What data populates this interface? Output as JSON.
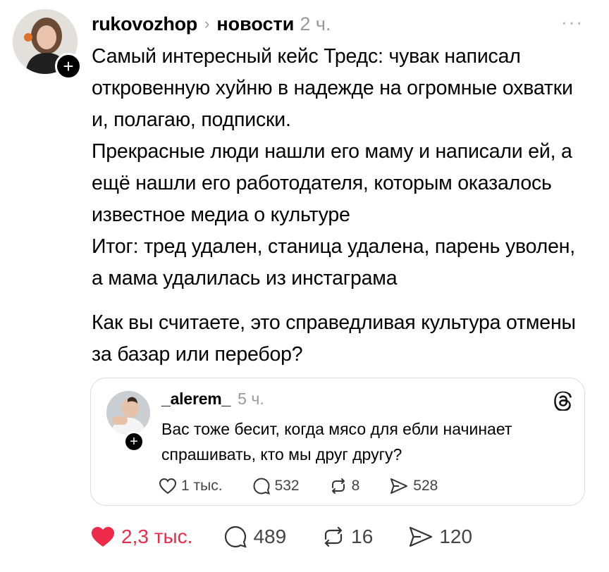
{
  "post": {
    "username": "rukovozhop",
    "topic": "новости",
    "time": "2 ч.",
    "more": "···",
    "follow": "+",
    "paragraphs": [
      "Самый интересный кейс Тредс: чувак написал откровенную хуйню в надежде на огромные охватки и, полагаю, подписки.",
      "Прекрасные люди нашли его маму и написали ей, а ещё нашли его работодателя, которым оказалось известное медиа о культуре",
      "Итог: тред удален, станица удалена, парень уволен, а мама удалилась из инстаграма",
      "Как вы считаете, это справедливая культура отмены за базар или перебор?"
    ],
    "actions": {
      "likes": "2,3 тыс.",
      "comments": "489",
      "reposts": "16",
      "shares": "120"
    }
  },
  "quoted": {
    "username": "_alerem_",
    "time": "5 ч.",
    "follow": "+",
    "text": "Вас тоже бесит, когда мясо для ебли начинает спрашивать, кто мы друг другу?",
    "actions": {
      "likes": "1 тыс.",
      "comments": "532",
      "reposts": "8",
      "shares": "528"
    }
  },
  "colors": {
    "like": "#ee2a4a",
    "muted": "#999999",
    "border": "#dcdcdc"
  }
}
